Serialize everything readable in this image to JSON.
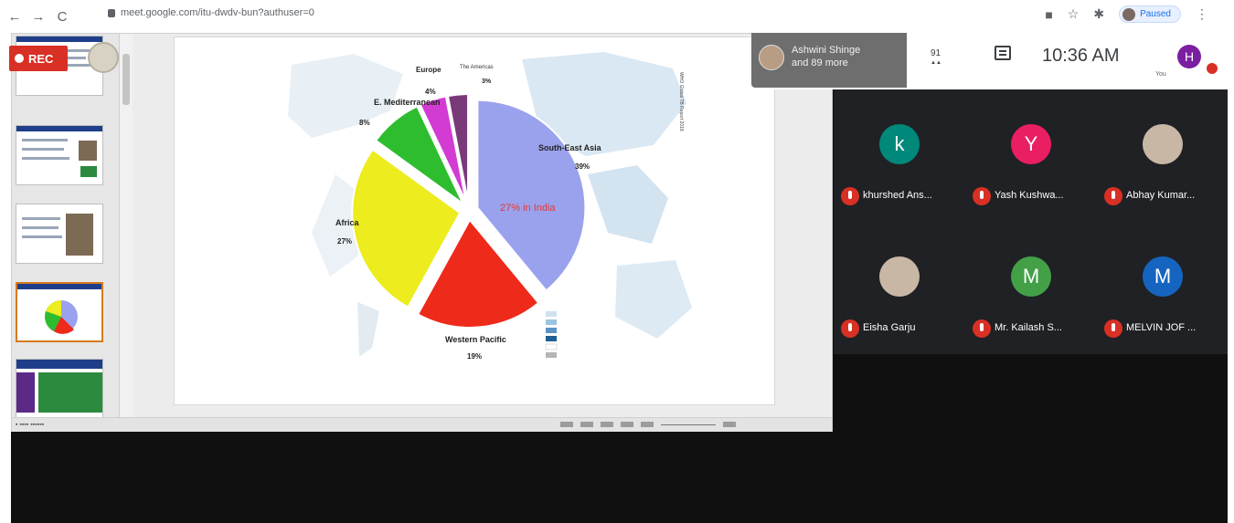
{
  "browser": {
    "back": "←",
    "forward": "→",
    "reload": "C",
    "url": "meet.google.com/itu-dwdv-bun?authuser=0",
    "paused_label": "Paused",
    "menu": "⋮"
  },
  "rec_label": "REC",
  "meet_info": {
    "presenter_line1": "Ashwini Shinge",
    "presenter_line2": "and 89 more",
    "people_count": "91",
    "time": "10:36 AM",
    "you_label": "You",
    "self_initial": "H"
  },
  "participants": [
    {
      "initial": "k",
      "name": "khurshed Ans...",
      "color": "#00897b"
    },
    {
      "initial": "Y",
      "name": "Yash Kushwa...",
      "color": "#e91e63"
    },
    {
      "initial": "",
      "name": "Abhay Kumar...",
      "color": "#c9b7a6"
    },
    {
      "initial": "",
      "name": "Eisha Garju",
      "color": "#c9b7a6"
    },
    {
      "initial": "M",
      "name": "Mr. Kailash S...",
      "color": "#43a047"
    },
    {
      "initial": "M",
      "name": "MELVIN JOF ...",
      "color": "#1565c0"
    }
  ],
  "slide": {
    "region_labels": [
      {
        "name": "Europe",
        "value": "4%"
      },
      {
        "name": "E. Mediterranean",
        "value": "8%"
      },
      {
        "name": "Africa",
        "value": "27%"
      },
      {
        "name": "Western Pacific",
        "value": "19%"
      },
      {
        "name": "South-East Asia",
        "value": "39%"
      }
    ],
    "highlight_text": "27% in India",
    "small_label_top": "The Americas",
    "small_label_top_value": "3%",
    "side_note": "WHO Global TB Report 2018"
  },
  "chart_data": {
    "type": "pie",
    "categories": [
      "South-East Asia",
      "Western Pacific",
      "Africa",
      "E. Mediterranean",
      "Europe",
      "The Americas"
    ],
    "values": [
      39,
      19,
      27,
      8,
      4,
      3
    ],
    "colors": [
      "#9aa2ee",
      "#ee2a1b",
      "#ecec1e",
      "#2ebd2e",
      "#d23cd2",
      "#7a3a7a"
    ],
    "annotations": [
      "27% in India"
    ]
  }
}
